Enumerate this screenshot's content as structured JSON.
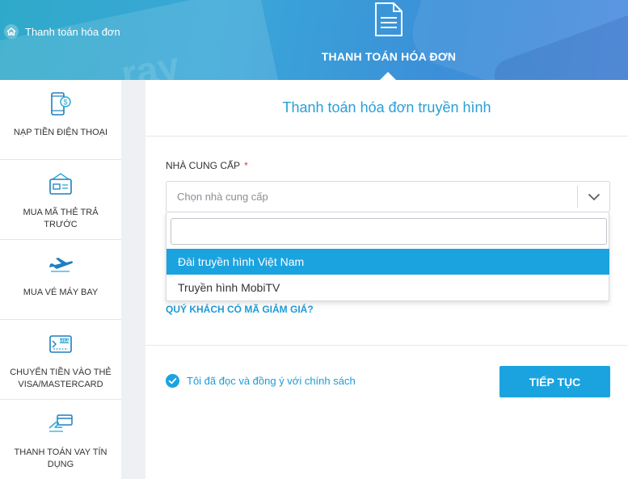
{
  "header": {
    "breadcrumb": "Thanh toán hóa đơn",
    "hero_title": "THANH TOÁN HÓA ĐƠN",
    "watermark": "ray"
  },
  "sidebar": {
    "items": [
      {
        "label": "NẠP TIỀN ĐIỆN THOẠI",
        "icon": "phone-dollar-icon"
      },
      {
        "label": "MUA MÃ THẺ TRẢ TRƯỚC",
        "icon": "prepaid-card-icon"
      },
      {
        "label": "MUA VÉ MÁY BAY",
        "icon": "airplane-icon"
      },
      {
        "label": "CHUYỂN TIỀN VÀO THẺ VISA/MASTERCARD",
        "icon": "visa-card-icon"
      },
      {
        "label": "THANH TOÁN VAY TÍN DỤNG",
        "icon": "credit-card-hand-icon"
      }
    ]
  },
  "form": {
    "title": "Thanh toán hóa đơn truyền hình",
    "provider_label": "NHÀ CUNG CẤP",
    "required_mark": "*",
    "provider_placeholder": "Chọn nhà cung cấp",
    "dropdown": {
      "search_value": "",
      "options": [
        "Đài truyền hình Việt Nam",
        "Truyền hình MobiTV"
      ],
      "active_index": 0
    },
    "promo_link": "QUÝ KHÁCH CÓ MÃ GIẢM GIÁ?",
    "agree_text": "Tôi đã đọc và đồng ý với chính sách",
    "agree_checked": true,
    "submit_label": "TIẾP TỤC"
  },
  "colors": {
    "accent": "#1ba3e0",
    "link": "#1e9ad6",
    "required": "#e53935"
  }
}
